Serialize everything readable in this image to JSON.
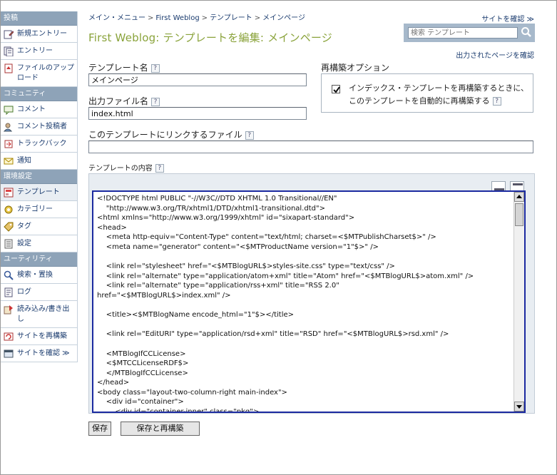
{
  "sidebar": {
    "sections": [
      {
        "title": "投稿",
        "items": [
          {
            "label": "新規エントリー",
            "icon": "new-entry-icon"
          },
          {
            "label": "エントリー",
            "icon": "entries-icon"
          },
          {
            "label": "ファイルのアップロード",
            "icon": "upload-icon"
          }
        ]
      },
      {
        "title": "コミュニティ",
        "items": [
          {
            "label": "コメント",
            "icon": "comment-icon"
          },
          {
            "label": "コメント投稿者",
            "icon": "commenter-icon"
          },
          {
            "label": "トラックバック",
            "icon": "trackback-icon"
          },
          {
            "label": "通知",
            "icon": "notification-icon"
          }
        ]
      },
      {
        "title": "環境設定",
        "items": [
          {
            "label": "テンプレート",
            "icon": "template-icon",
            "active": true
          },
          {
            "label": "カテゴリー",
            "icon": "category-icon"
          },
          {
            "label": "タグ",
            "icon": "tag-icon"
          },
          {
            "label": "設定",
            "icon": "settings-icon"
          }
        ]
      },
      {
        "title": "ユーティリティ",
        "items": [
          {
            "label": "検索・置換",
            "icon": "search-icon"
          },
          {
            "label": "ログ",
            "icon": "log-icon"
          },
          {
            "label": "読み込み/書き出し",
            "icon": "import-export-icon"
          },
          {
            "label": "サイトを再構築",
            "icon": "rebuild-icon"
          },
          {
            "label": "サイトを確認 ≫",
            "icon": "view-site-icon"
          }
        ]
      }
    ]
  },
  "breadcrumb": [
    "メイン・メニュー",
    "First Weblog",
    "テンプレート",
    "メインページ"
  ],
  "breadcrumb_sep": ">",
  "header": {
    "view_site": "サイトを確認 ≫",
    "title": "First Weblog: テンプレートを編集: メインページ",
    "search_placeholder": "検索 テンプレート",
    "published_link": "出力されたページを確認"
  },
  "form": {
    "name_label": "テンプレート名",
    "name_value": "メインページ",
    "outfile_label": "出力ファイル名",
    "outfile_value": "index.html",
    "linked_label": "このテンプレートにリンクするファイル",
    "linked_value": "",
    "rebuild_label": "再構築オプション",
    "rebuild_option": "インデックス・テンプレートを再構築するときに、このテンプレートを自動的に再構築する",
    "rebuild_checked": true,
    "content_label": "テンプレートの内容",
    "help_mark": "?"
  },
  "template_code": "<!DOCTYPE html PUBLIC \"-//W3C//DTD XHTML 1.0 Transitional//EN\"\n    \"http://www.w3.org/TR/xhtml1/DTD/xhtml1-transitional.dtd\">\n<html xmlns=\"http://www.w3.org/1999/xhtml\" id=\"sixapart-standard\">\n<head>\n    <meta http-equiv=\"Content-Type\" content=\"text/html; charset=<$MTPublishCharset$>\" />\n    <meta name=\"generator\" content=\"<$MTProductName version=\"1\"$>\" />\n\n    <link rel=\"stylesheet\" href=\"<$MTBlogURL$>styles-site.css\" type=\"text/css\" />\n    <link rel=\"alternate\" type=\"application/atom+xml\" title=\"Atom\" href=\"<$MTBlogURL$>atom.xml\" />\n    <link rel=\"alternate\" type=\"application/rss+xml\" title=\"RSS 2.0\"\nhref=\"<$MTBlogURL$>index.xml\" />\n\n    <title><$MTBlogName encode_html=\"1\"$></title>\n\n    <link rel=\"EditURI\" type=\"application/rsd+xml\" title=\"RSD\" href=\"<$MTBlogURL$>rsd.xml\" />\n\n    <MTBlogIfCCLicense>\n    <$MTCCLicenseRDF$>\n    </MTBlogIfCCLicense>\n</head>\n<body class=\"layout-two-column-right main-index\">\n    <div id=\"container\">\n        <div id=\"container-inner\" class=\"pkg\">",
  "buttons": {
    "save": "保存",
    "save_rebuild": "保存と再構築"
  }
}
